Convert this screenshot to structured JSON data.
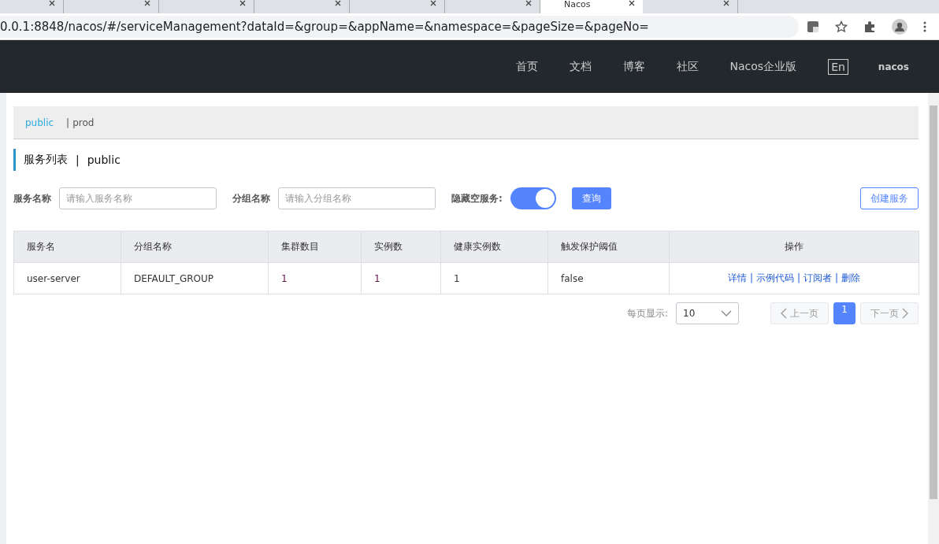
{
  "browser": {
    "tabs": [
      {
        "selected": false
      },
      {
        "selected": false
      },
      {
        "selected": false
      },
      {
        "selected": false
      },
      {
        "selected": false
      },
      {
        "selected": false
      },
      {
        "title": "Nacos",
        "selected": true
      },
      {
        "selected": false
      }
    ],
    "url": "0.0.1:8848/nacos/#/serviceManagement?dataId=&group=&appName=&namespace=&pageSize=&pageNo="
  },
  "header": {
    "nav": [
      "首页",
      "文档",
      "博客",
      "社区",
      "Nacos企业版"
    ],
    "language": "En",
    "user": "nacos"
  },
  "namespaces": [
    {
      "label": "public",
      "selected": true
    },
    {
      "separator": "|",
      "label": "prod",
      "selected": false
    }
  ],
  "page_title": {
    "label": "服务列表",
    "separator": "|",
    "namespace": "public"
  },
  "filters": {
    "service_name": {
      "label": "服务名称",
      "placeholder": "请输入服务名称"
    },
    "group_name": {
      "label": "分组名称",
      "placeholder": "请输入分组名称"
    },
    "hide_empty": {
      "label": "隐藏空服务:",
      "on": true
    },
    "query_button": "查询",
    "create_button": "创建服务"
  },
  "table": {
    "columns": [
      "服务名",
      "分组名称",
      "集群数目",
      "实例数",
      "健康实例数",
      "触发保护阈值",
      "操作"
    ],
    "rows": [
      {
        "cells": [
          "user-server",
          "DEFAULT_GROUP",
          "1",
          "1",
          "1",
          "false"
        ],
        "actions": [
          "详情",
          "示例代码",
          "订阅者",
          "删除"
        ],
        "action_separators": [
          "|",
          "|",
          "|"
        ]
      }
    ]
  },
  "pagination": {
    "page_size_label": "每页显示:",
    "page_size": "10",
    "prev": {
      "label": "上一页",
      "disabled": true
    },
    "pages": [
      {
        "label": "1",
        "selected": true
      }
    ],
    "next": {
      "label": "下一页",
      "disabled": true
    }
  }
}
